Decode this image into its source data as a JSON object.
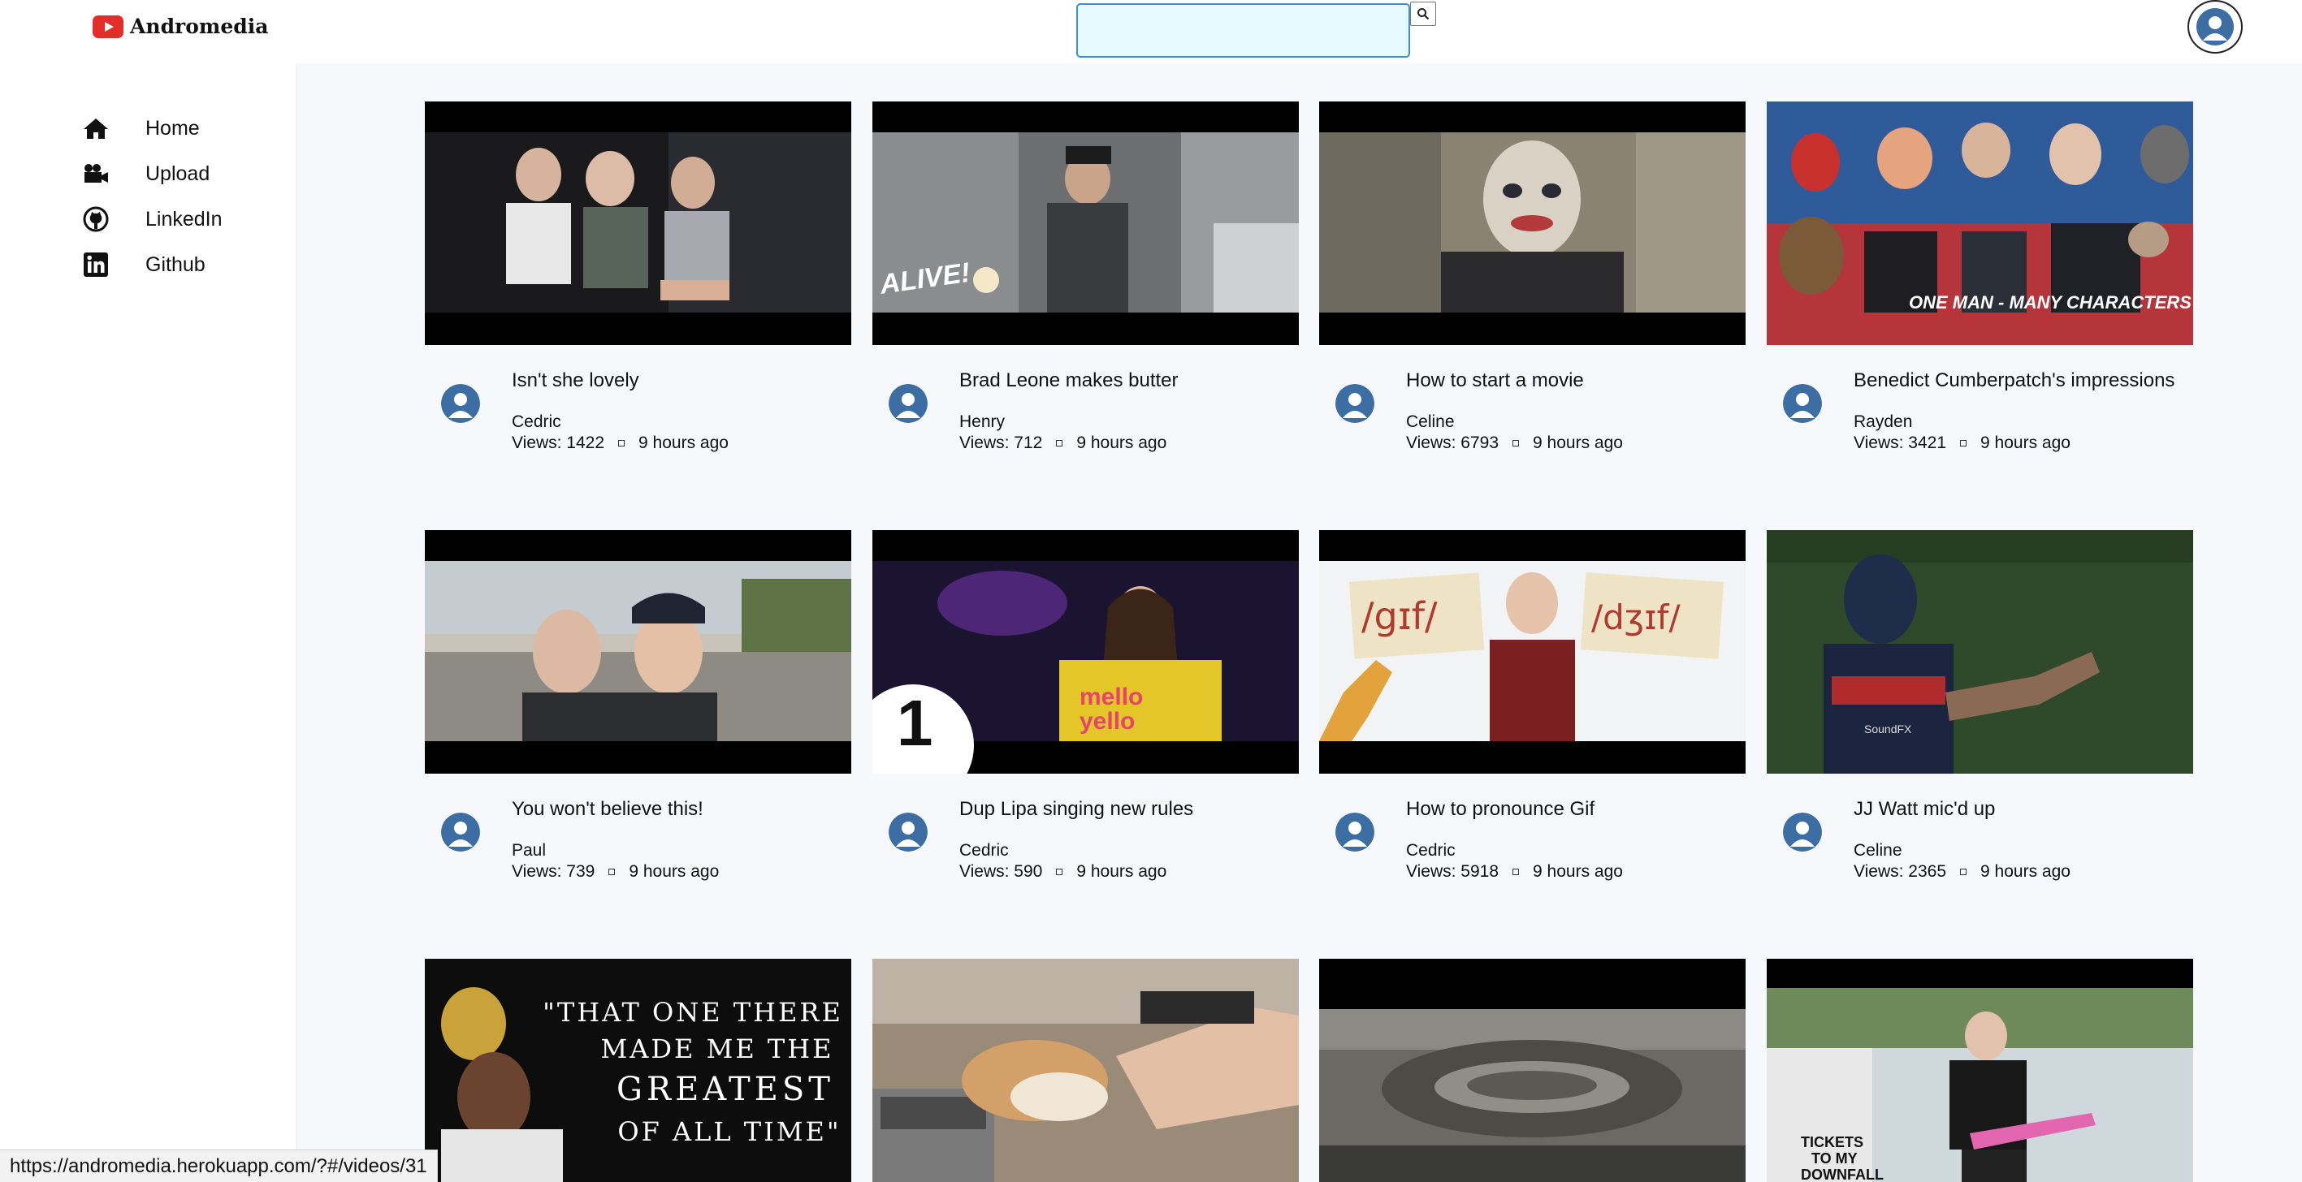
{
  "app": {
    "name": "Andromedia"
  },
  "search": {
    "value": "",
    "placeholder": ""
  },
  "sidebar": {
    "items": [
      {
        "label": "Home",
        "icon": "home-icon"
      },
      {
        "label": "Upload",
        "icon": "video-camera-icon"
      },
      {
        "label": "LinkedIn",
        "icon": "github-icon"
      },
      {
        "label": "Github",
        "icon": "linkedin-icon"
      }
    ]
  },
  "videos": [
    {
      "title": "Isn't she lovely",
      "author": "Cedric",
      "views": "Views: 1422",
      "time": "9 hours ago"
    },
    {
      "title": "Brad Leone makes butter",
      "author": "Henry",
      "views": "Views: 712",
      "time": "9 hours ago"
    },
    {
      "title": "How to start a movie",
      "author": "Celine",
      "views": "Views: 6793",
      "time": "9 hours ago"
    },
    {
      "title": "Benedict Cumberpatch's impressions",
      "author": "Rayden",
      "views": "Views: 3421",
      "time": "9 hours ago",
      "overlay": "ONE MAN - MANY CHARACTERS"
    },
    {
      "title": "You won't believe this!",
      "author": "Paul",
      "views": "Views: 739",
      "time": "9 hours ago"
    },
    {
      "title": "Dup Lipa singing new rules",
      "author": "Cedric",
      "views": "Views: 590",
      "time": "9 hours ago"
    },
    {
      "title": "How to pronounce Gif",
      "author": "Cedric",
      "views": "Views: 5918",
      "time": "9 hours ago",
      "overlay_left": "/gɪf/",
      "overlay_right": "/dʒɪf/"
    },
    {
      "title": "JJ Watt mic'd up",
      "author": "Celine",
      "views": "Views: 2365",
      "time": "9 hours ago"
    },
    {
      "overlay": [
        "\"THAT ONE THERE",
        "MADE ME THE",
        "GREATEST",
        "OF ALL TIME\""
      ]
    },
    {},
    {},
    {}
  ],
  "status_url": "https://andromedia.herokuapp.com/?#/videos/31",
  "colors": {
    "brand_red": "#e52d27",
    "search_border": "#3b8fd6",
    "search_bg": "#e6fbff",
    "main_bg": "#f7f8fc",
    "avatar_blue": "#3d6ea3"
  }
}
